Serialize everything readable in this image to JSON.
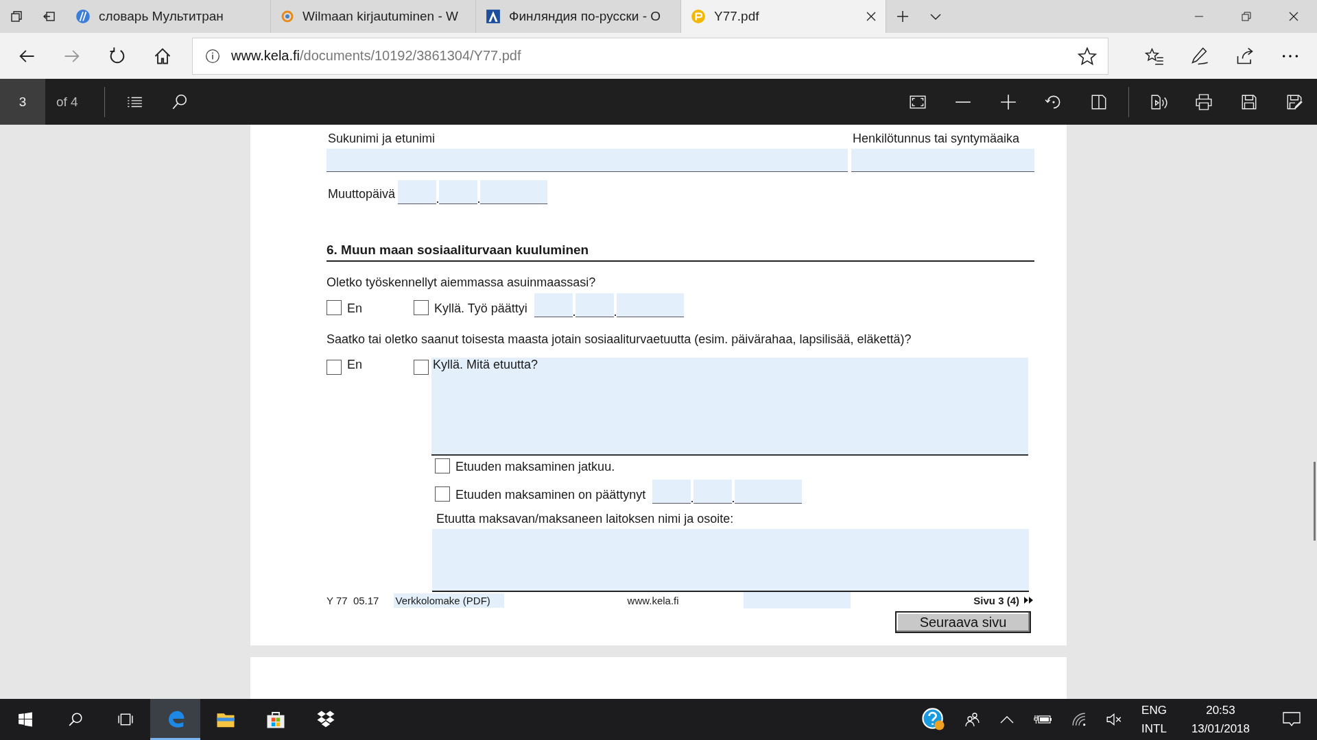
{
  "browser": {
    "tabs": [
      {
        "label": "словарь Мультитран",
        "selected": false,
        "kind": "multitran"
      },
      {
        "label": "Wilmaan kirjautuminen - W",
        "selected": false,
        "kind": "wilma"
      },
      {
        "label": "Финляндия по-русски - О",
        "selected": false,
        "kind": "finland"
      },
      {
        "label": "Y77.pdf",
        "selected": true,
        "kind": "pdf"
      }
    ],
    "address": {
      "host": "www.kela.fi",
      "path": "/documents/10192/3861304/Y77.pdf"
    }
  },
  "pdf_toolbar": {
    "page": "3",
    "page_count": "of 4"
  },
  "form": {
    "name_label": "Sukunimi ja etunimi",
    "id_label": "Henkilötunnus tai syntymäaika",
    "move_date_label": "Muuttopäivä",
    "section_title": "6. Muun maan sosiaaliturvaan kuuluminen",
    "question_1": {
      "text": "Oletko työskennellyt aiemmassa asuinmaassasi?",
      "options": [
        {
          "label": "En",
          "checked": false,
          "kind": "plain"
        },
        {
          "label": "Kyllä. Työ päättyi",
          "checked": false,
          "kind": "date"
        }
      ]
    },
    "question_2": {
      "text": "Saatko tai oletko saanut toisesta maasta jotain sosiaaliturvaetuutta (esim. päivärahaa, lapsilisää, eläkettä)?",
      "options": [
        {
          "label": "En",
          "checked": false,
          "kind": "plain"
        },
        {
          "label": "Kyllä. Mitä etuutta?",
          "checked": false,
          "kind": "text"
        }
      ]
    },
    "benefit_status": [
      {
        "label": "Etuuden maksaminen jatkuu.",
        "checked": false,
        "kind": "plain"
      },
      {
        "label": "Etuuden maksaminen on päättynyt",
        "checked": false,
        "kind": "date"
      }
    ],
    "institution_label": "Etuutta maksavan/maksaneen laitoksen nimi ja osoite:"
  },
  "footer": {
    "form_code": "Y 77  05.17",
    "form_type": "Verkkolomake (PDF)",
    "website": "www.kela.fi",
    "page_label": "Sivu 3 (4)",
    "next_button": "Seuraava sivu"
  },
  "taskbar": {
    "language": "ENG",
    "layout": "INTL",
    "time": "20:53",
    "date": "13/01/2018"
  }
}
